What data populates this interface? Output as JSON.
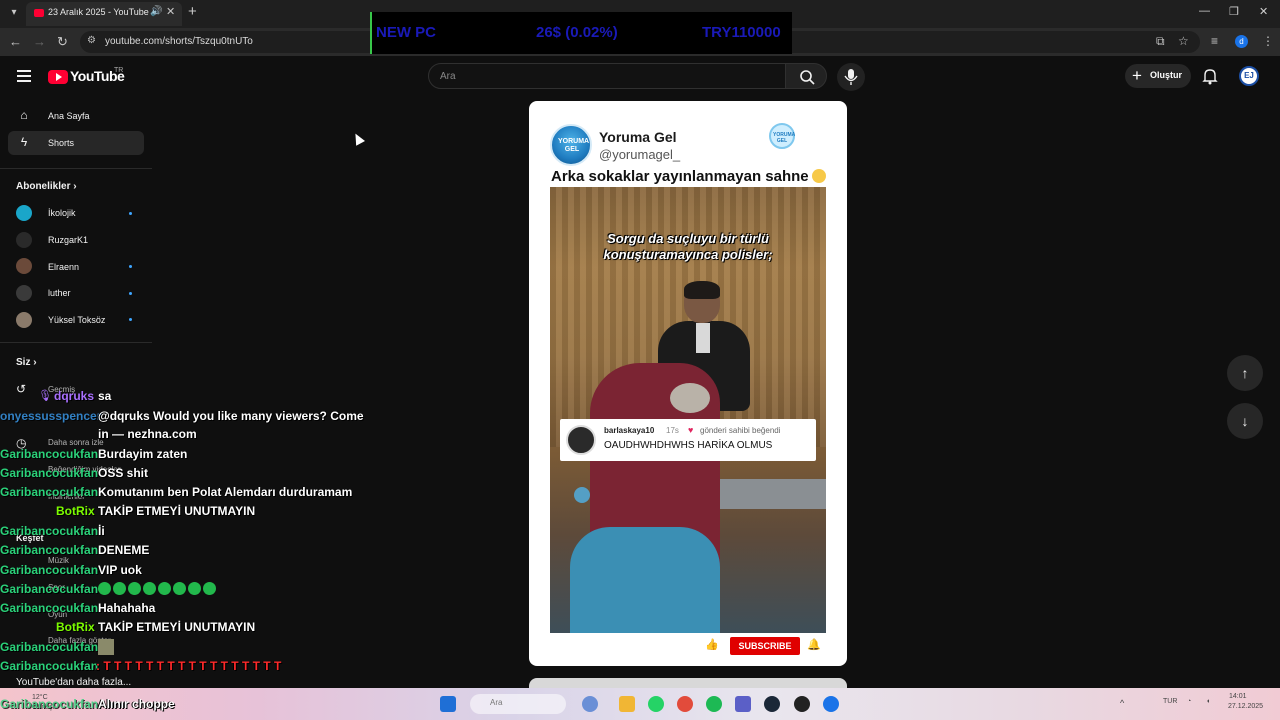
{
  "browser": {
    "tab_title": "23 Aralık 2025 - YouTube",
    "url": "youtube.com/shorts/Tszqu0tnUTo"
  },
  "stream_overlay": {
    "label": "NEW PC",
    "change": "26$ (0.02%)",
    "amount": "TRY110000"
  },
  "header": {
    "logo_text": "YouTube",
    "region": "TR",
    "search_placeholder": "Ara",
    "create_label": "Oluştur",
    "avatar_text": "EJ"
  },
  "sidebar": {
    "home": "Ana Sayfa",
    "shorts": "Shorts",
    "subscriptions_heading": "Abonelikler",
    "subscriptions": [
      {
        "name": "İkolojik",
        "color": "#1aa6c9",
        "new": true
      },
      {
        "name": "RuzgarK1",
        "color": "#2a2a2a",
        "new": false
      },
      {
        "name": "Elraenn",
        "color": "#6b4a3a",
        "new": true
      },
      {
        "name": "luther",
        "color": "#3a3a3a",
        "new": true
      },
      {
        "name": "Yüksel Toksöz",
        "color": "#8a7a6a",
        "new": true
      }
    ],
    "you_heading": "Siz",
    "history": "Geçmiş",
    "watch_later": "Daha sonra izle",
    "liked": "Beğendiğim videolar",
    "downloads": "İndirilenler",
    "explore_heading": "Keşfet",
    "music": "Müzik",
    "sports": "Spor",
    "gaming": "Oyun",
    "more": "Daha fazla göster",
    "more_youtube": "YouTube'dan daha fazla..."
  },
  "short": {
    "channel_name": "Yoruma Gel",
    "channel_handle": "@yorumagel_",
    "logo_text": "YORUMA GEL",
    "caption": "Arka sokaklar yayınlanmayan sahne",
    "video_text_line1": "Sorgu da suçluyu bir türlü",
    "video_text_line2": "konuşturamayınca polisler;",
    "comment_user": "barlaskaya10",
    "comment_time": "17s",
    "comment_liked": "gönderi sahibi beğendi",
    "comment_text": "OAUDHWHDHWHS HARİKA OLMUS",
    "subscribe_label": "SUBSCRIBE"
  },
  "chat": [
    {
      "user": "dqruks",
      "user_color": "#a970ff",
      "message": "sa"
    },
    {
      "user": "",
      "user_color": "#ffffff",
      "message": "@dqruks Would you like many viewers? Come"
    },
    {
      "user": "",
      "user_color": "#ffffff",
      "message": "in — nezhna.com"
    },
    {
      "user": "Garibancocukfan",
      "user_color": "#2bd27a",
      "message": "Burdayim zaten"
    },
    {
      "user": "Garibancocukfan",
      "user_color": "#2bd27a",
      "message": "OSS shit"
    },
    {
      "user": "Garibancocukfan",
      "user_color": "#2bd27a",
      "message": "Komutanım ben Polat Alemdarı durduramam"
    },
    {
      "user": "BotRix",
      "user_color": "#7cfc00",
      "message": "TAKİP ETMEYİ UNUTMAYIN"
    },
    {
      "user": "Garibancocukfan",
      "user_color": "#2bd27a",
      "message": "İi"
    },
    {
      "user": "Garibancocukfan",
      "user_color": "#2bd27a",
      "message": "DENEME"
    },
    {
      "user": "Garibancocukfan",
      "user_color": "#2bd27a",
      "message": "VIP uok"
    },
    {
      "user": "Garibancocukfan",
      "user_color": "#2bd27a",
      "message": ""
    },
    {
      "user": "Garibancocukfan",
      "user_color": "#2bd27a",
      "message": "Hahahaha"
    },
    {
      "user": "BotRix",
      "user_color": "#7cfc00",
      "message": "TAKİP ETMEYİ UNUTMAYIN"
    },
    {
      "user": "Garibancocukfan",
      "user_color": "#2bd27a",
      "message": ""
    },
    {
      "user": "Garibancocukfan",
      "user_color": "#2bd27a",
      "message": ": T T T T T T T T T T T T T T T T T"
    },
    {
      "user": "Garibancocukfan",
      "user_color": "#2bd27a",
      "message": "Alınır choppe"
    }
  ],
  "chat_overlap_name": "onyessusspencer",
  "taskbar": {
    "weather": "12°C",
    "weather_desc": "Güneşli",
    "search_placeholder": "Ara",
    "lang": "TUR",
    "time": "14:01",
    "date": "27.12.2025"
  },
  "colors": {
    "youtube_red": "#ff0033",
    "background": "#0f0f0f",
    "subscribe_red": "#e00000"
  }
}
